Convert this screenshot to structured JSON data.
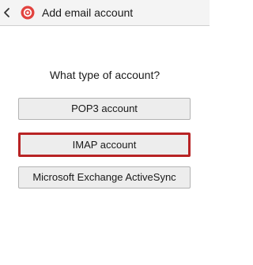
{
  "header": {
    "title": "Add email account",
    "back_icon": "chevron-left-icon",
    "app_icon": "email-app-icon",
    "accent_color": "#e2433f"
  },
  "main": {
    "question": "What type of account?",
    "options": [
      {
        "label": "POP3 account",
        "highlighted": false
      },
      {
        "label": "IMAP account",
        "highlighted": true
      },
      {
        "label": "Microsoft Exchange ActiveSync",
        "highlighted": false
      }
    ],
    "highlight_color": "#b82324"
  }
}
